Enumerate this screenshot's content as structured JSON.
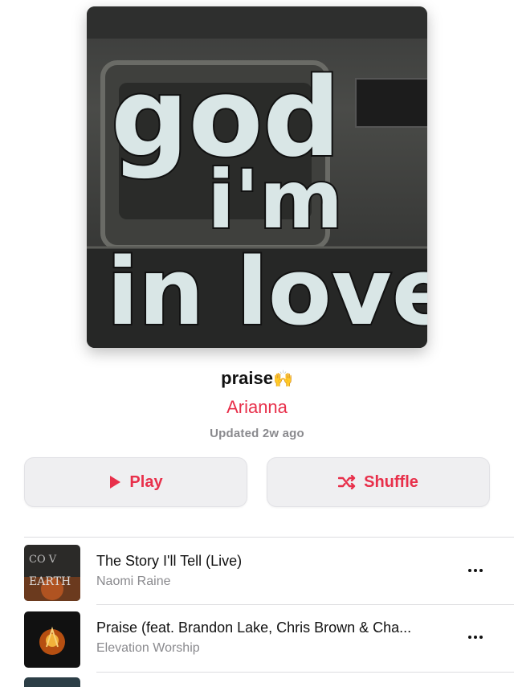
{
  "playlist": {
    "artwork_text": "god i'm in love",
    "title": "praise",
    "title_emoji": "🙌",
    "curator": "Arianna",
    "updated": "Updated 2w ago"
  },
  "actions": {
    "play_label": "Play",
    "shuffle_label": "Shuffle"
  },
  "tracks": [
    {
      "title": "The Story I'll Tell (Live)",
      "artist": "Naomi Raine"
    },
    {
      "title": "Praise (feat. Brandon Lake, Chris Brown & Cha...",
      "artist": "Elevation Worship"
    }
  ],
  "colors": {
    "accent": "#e8304b",
    "secondary_text": "#8a8a8e",
    "button_bg": "#efeff1"
  }
}
